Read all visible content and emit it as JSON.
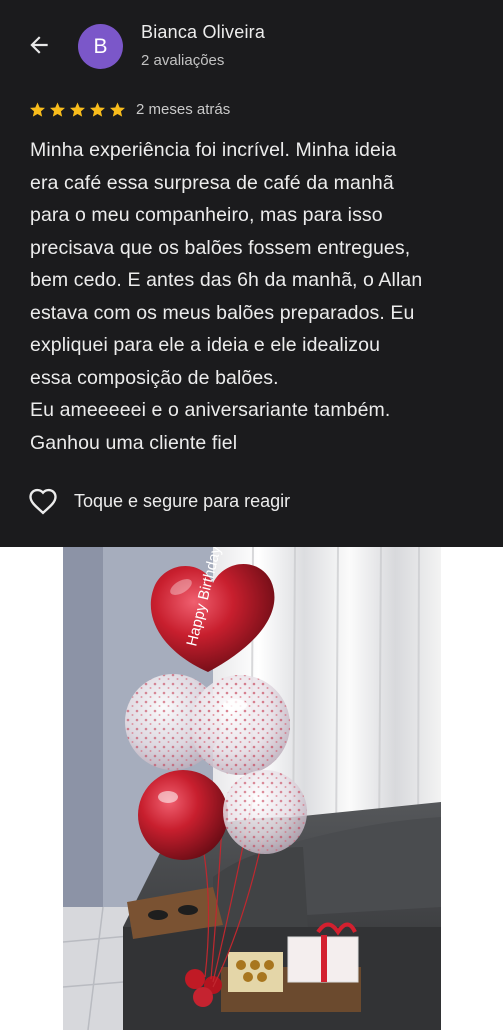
{
  "reviewer": {
    "avatar_initial": "B",
    "avatar_color": "#7b57c9",
    "name": "Bianca Oliveira",
    "reviews_count": "2 avaliações"
  },
  "review": {
    "rating": 5,
    "time_ago": "2 meses atrás",
    "text": "Minha experiência foi incrível. Minha ideia\nera café essa surpresa de café da manhã\npara o meu companheiro, mas para isso\nprecisava que os balões fossem entregues,\nbem cedo. E antes das 6h da manhã, o Allan\nestava com os meus balões preparados.  Eu\nexpliquei para ele a ideia e ele idealizou\nessa composição de balões.\nEu ameeeeei e o aniversariante também.\nGanhou uma cliente fiel"
  },
  "reaction": {
    "label": "Toque e segure para reagir",
    "icon": "heart-outline-icon"
  },
  "navigation": {
    "back_icon": "arrow-back-icon"
  },
  "photo": {
    "balloon_text": "Happy Birthday!"
  },
  "colors": {
    "header_background": "#1b1b1d",
    "star_color": "#f8bc1c",
    "text_color": "#ececec"
  }
}
